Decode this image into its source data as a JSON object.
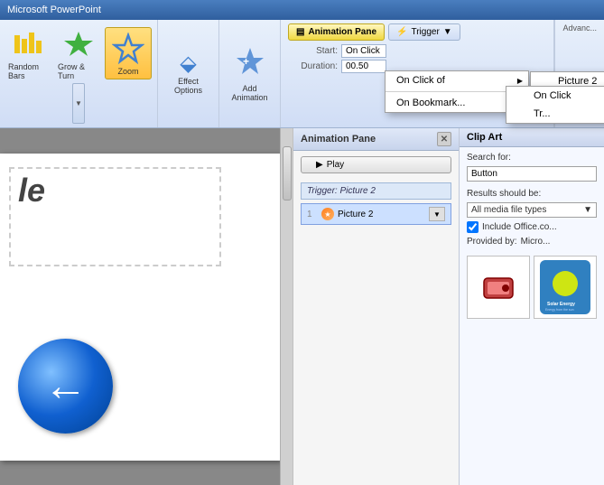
{
  "titlebar": {
    "label": "Microsoft PowerPoint"
  },
  "ribbon": {
    "groups": [
      {
        "id": "animations",
        "buttons": [
          {
            "id": "random-bars",
            "label": "Random Bars",
            "icon": "✦"
          },
          {
            "id": "grow-turn",
            "label": "Grow & Turn",
            "icon": "✦"
          },
          {
            "id": "zoom",
            "label": "Zoom",
            "icon": "✦",
            "selected": true
          }
        ]
      },
      {
        "id": "effect-options",
        "label": "Effect Options",
        "icon": "⬙"
      },
      {
        "id": "add-animation",
        "label": "Add Animation",
        "icon": "✦"
      },
      {
        "id": "animation-pane",
        "animation_pane_label": "Animation Pane",
        "trigger_label": "Trigger"
      }
    ],
    "timing": {
      "start_label": "Start:",
      "start_value": "On Click",
      "duration_label": "Duration:",
      "duration_value": "00.50"
    },
    "advance_label": "Advanc..."
  },
  "trigger_dropdown": {
    "items": [
      {
        "id": "on-click-of",
        "label": "On Click of",
        "has_submenu": true,
        "checked": false
      },
      {
        "id": "on-bookmark",
        "label": "On Bookmark...",
        "has_submenu": false,
        "checked": false
      }
    ],
    "submenu": {
      "items": [
        {
          "id": "picture2-1",
          "label": "Picture 2",
          "checked": false
        },
        {
          "id": "picture2-2",
          "label": "Picture 2",
          "checked": true
        }
      ]
    }
  },
  "timing_dropdown": {
    "title": "On Click",
    "items": [
      {
        "id": "on-click",
        "label": "On Click",
        "checked": false
      },
      {
        "id": "tr-label",
        "label": "Tr...",
        "checked": false
      }
    ]
  },
  "animation_pane": {
    "title": "Animation Pane",
    "play_label": "▶  Play",
    "trigger_line": "Trigger: Picture 2",
    "items": [
      {
        "id": "anim1",
        "number": "1",
        "label": "Picture 2",
        "selected": true
      }
    ]
  },
  "clip_art": {
    "title": "Clip Art",
    "search_label": "Search for:",
    "search_value": "Button",
    "results_label": "Results should be:",
    "results_value": "All media file types",
    "include_label": "Include Office.co...",
    "provided_label": "Provided by:",
    "provided_value": "Micro...",
    "images": [
      {
        "id": "img1",
        "color": "#c04040"
      },
      {
        "id": "img2",
        "color": "#3080c0"
      }
    ]
  },
  "slide": {
    "title_text": "le",
    "back_arrow": "←"
  }
}
